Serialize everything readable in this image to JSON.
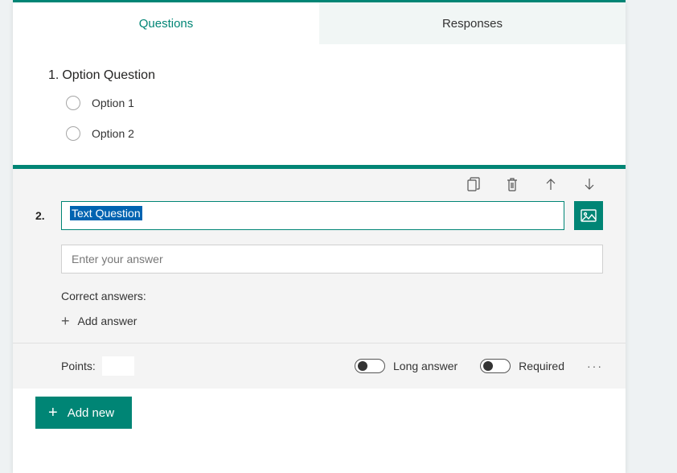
{
  "accent_color": "#008575",
  "tabs": {
    "questions": "Questions",
    "responses": "Responses"
  },
  "question1": {
    "number": "1.",
    "title": "Option Question",
    "options": [
      "Option 1",
      "Option 2"
    ]
  },
  "question2": {
    "number": "2.",
    "title": "Text Question",
    "answer_placeholder": "Enter your answer",
    "correct_label": "Correct answers:",
    "add_answer_label": "Add answer",
    "points_label": "Points:",
    "long_answer_label": "Long answer",
    "long_answer_on": false,
    "required_label": "Required",
    "required_on": false
  },
  "add_new_label": "Add new"
}
